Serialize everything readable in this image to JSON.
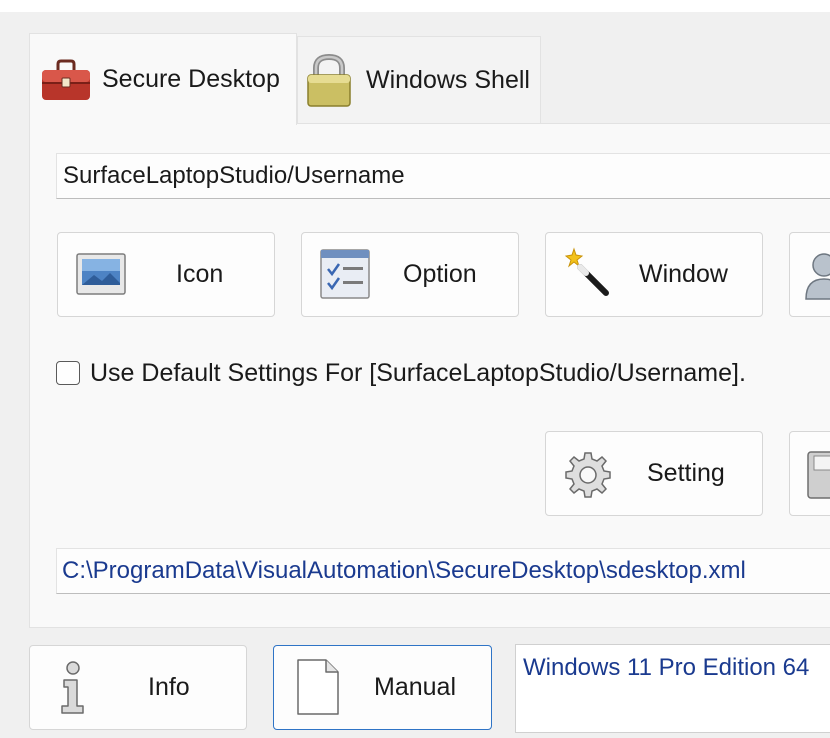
{
  "tabs": [
    {
      "label": "Secure Desktop",
      "icon": "toolbox-icon",
      "active": true
    },
    {
      "label": "Windows Shell",
      "icon": "padlock-icon",
      "active": false
    }
  ],
  "profile": {
    "value": "SurfaceLaptopStudio/Username"
  },
  "buttons": {
    "icon": {
      "label": "Icon",
      "icon": "picture-icon"
    },
    "option": {
      "label": "Option",
      "icon": "checklist-icon"
    },
    "window": {
      "label": "Window",
      "icon": "magic-wand-icon"
    },
    "setting": {
      "label": "Setting",
      "icon": "gear-icon"
    }
  },
  "default_settings": {
    "label": "Use Default Settings For [SurfaceLaptopStudio/Username].",
    "checked": false
  },
  "config_path": {
    "value": "C:\\ProgramData\\VisualAutomation\\SecureDesktop\\sdesktop.xml"
  },
  "footer": {
    "info": {
      "label": "Info",
      "icon": "info-icon"
    },
    "manual": {
      "label": "Manual",
      "icon": "document-icon"
    },
    "os_text": "Windows 11 Pro Edition 64"
  },
  "colors": {
    "accent_text": "#1a3a8f",
    "toolbox_red": "#c0392b",
    "lock_yellow": "#d4c66a",
    "focus_border": "#2f74c6"
  }
}
